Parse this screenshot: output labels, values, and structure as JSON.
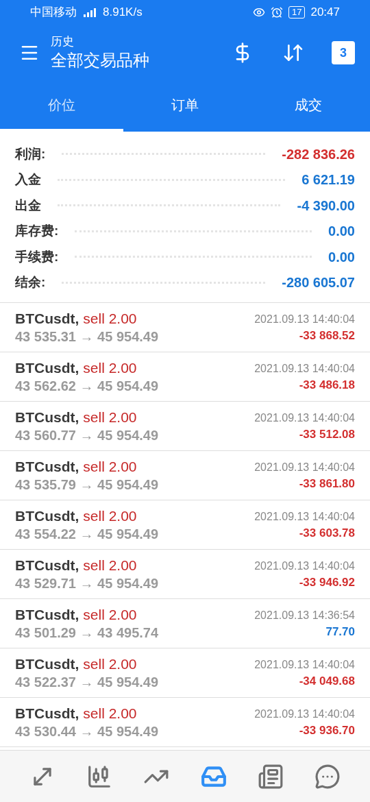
{
  "status_bar": {
    "carrier": "中国移动",
    "speed": "8.91K/s",
    "battery": "17",
    "time": "20:47"
  },
  "header": {
    "title": "历史",
    "subtitle": "全部交易品种",
    "calendar_day": "3"
  },
  "tabs": [
    {
      "label": "价位",
      "selected": true
    },
    {
      "label": "订单",
      "selected": false
    },
    {
      "label": "成交",
      "selected": false
    }
  ],
  "summary": [
    {
      "label": "利润:",
      "value": "-282 836.26",
      "color": "#d32f2f"
    },
    {
      "label": "入金",
      "value": "6 621.19",
      "color": "#1976d2"
    },
    {
      "label": "出金",
      "value": "-4 390.00",
      "color": "#1976d2"
    },
    {
      "label": "库存费:",
      "value": "0.00",
      "color": "#1976d2"
    },
    {
      "label": "手续费:",
      "value": "0.00",
      "color": "#1976d2"
    },
    {
      "label": "结余:",
      "value": "-280 605.07",
      "color": "#1976d2"
    }
  ],
  "trades": [
    {
      "symbol": "BTCusdt,",
      "side": "sell 2.00",
      "prices": "43 535.31 → 45 954.49",
      "time": "2021.09.13 14:40:04",
      "profit": "-33 868.52",
      "color": "#d32f2f"
    },
    {
      "symbol": "BTCusdt,",
      "side": "sell 2.00",
      "prices": "43 562.62 → 45 954.49",
      "time": "2021.09.13 14:40:04",
      "profit": "-33 486.18",
      "color": "#d32f2f"
    },
    {
      "symbol": "BTCusdt,",
      "side": "sell 2.00",
      "prices": "43 560.77 → 45 954.49",
      "time": "2021.09.13 14:40:04",
      "profit": "-33 512.08",
      "color": "#d32f2f"
    },
    {
      "symbol": "BTCusdt,",
      "side": "sell 2.00",
      "prices": "43 535.79 → 45 954.49",
      "time": "2021.09.13 14:40:04",
      "profit": "-33 861.80",
      "color": "#d32f2f"
    },
    {
      "symbol": "BTCusdt,",
      "side": "sell 2.00",
      "prices": "43 554.22 → 45 954.49",
      "time": "2021.09.13 14:40:04",
      "profit": "-33 603.78",
      "color": "#d32f2f"
    },
    {
      "symbol": "BTCusdt,",
      "side": "sell 2.00",
      "prices": "43 529.71 → 45 954.49",
      "time": "2021.09.13 14:40:04",
      "profit": "-33 946.92",
      "color": "#d32f2f"
    },
    {
      "symbol": "BTCusdt,",
      "side": "sell 2.00",
      "prices": "43 501.29 → 43 495.74",
      "time": "2021.09.13 14:36:54",
      "profit": "77.70",
      "color": "#1976d2"
    },
    {
      "symbol": "BTCusdt,",
      "side": "sell 2.00",
      "prices": "43 522.37 → 45 954.49",
      "time": "2021.09.13 14:40:04",
      "profit": "-34 049.68",
      "color": "#d32f2f"
    },
    {
      "symbol": "BTCusdt,",
      "side": "sell 2.00",
      "prices": "43 530.44 → 45 954.49",
      "time": "2021.09.13 14:40:04",
      "profit": "-33 936.70",
      "color": "#d32f2f"
    }
  ],
  "bottom_nav": [
    {
      "kind": "quotes",
      "selected": false
    },
    {
      "kind": "chart",
      "selected": false
    },
    {
      "kind": "trade",
      "selected": false
    },
    {
      "kind": "history",
      "selected": true
    },
    {
      "kind": "news",
      "selected": false
    },
    {
      "kind": "messages",
      "selected": false
    }
  ]
}
